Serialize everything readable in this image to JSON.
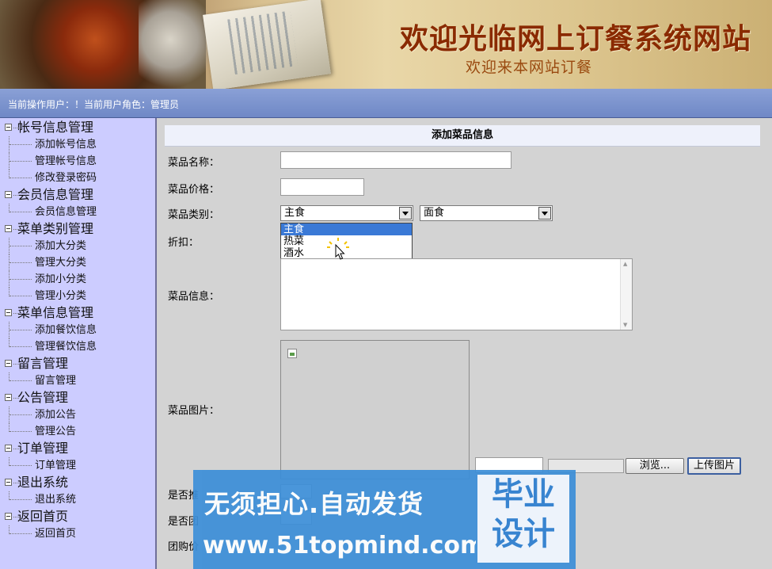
{
  "banner": {
    "title": "欢迎光临网上订餐系统网站",
    "subtitle": "欢迎来本网站订餐"
  },
  "userbar": {
    "text": "当前操作用户：！当前用户角色：管理员"
  },
  "sidebar": {
    "groups": [
      {
        "label": "帐号信息管理",
        "items": [
          "添加帐号信息",
          "管理帐号信息",
          "修改登录密码"
        ]
      },
      {
        "label": "会员信息管理",
        "items": [
          "会员信息管理"
        ]
      },
      {
        "label": "菜单类别管理",
        "items": [
          "添加大分类",
          "管理大分类",
          "添加小分类",
          "管理小分类"
        ]
      },
      {
        "label": "菜单信息管理",
        "items": [
          "添加餐饮信息",
          "管理餐饮信息"
        ]
      },
      {
        "label": "留言管理",
        "items": [
          "留言管理"
        ]
      },
      {
        "label": "公告管理",
        "items": [
          "添加公告",
          "管理公告"
        ]
      },
      {
        "label": "订单管理",
        "items": [
          "订单管理"
        ]
      },
      {
        "label": "退出系统",
        "items": [
          "退出系统"
        ]
      },
      {
        "label": "返回首页",
        "items": [
          "返回首页"
        ]
      }
    ]
  },
  "form": {
    "header": "添加菜品信息",
    "name_label": "菜品名称：",
    "name_value": "",
    "price_label": "菜品价格：",
    "price_value": "",
    "category_label": "菜品类别：",
    "category_main_selected": "主食",
    "category_sub_selected": "面食",
    "category_options": [
      "主食",
      "热菜",
      "酒水"
    ],
    "discount_label": "折扣：",
    "info_label": "菜品信息：",
    "info_value": "",
    "image_label": "菜品图片：",
    "browse_button": "浏览...",
    "upload_button": "上传图片",
    "rec_label_partial": "是否推",
    "group_label_partial": "是否团",
    "group_price_label_partial": "团购价"
  },
  "watermark": {
    "line1": "无须担心.自动发货",
    "line2": "www.51topmind.com",
    "box_line1": "毕业",
    "box_line2": "设计"
  },
  "colors": {
    "sidebar_bg": "#ccccff",
    "userbar_bg": "#6f88c6",
    "dropdown_selected": "#3a79d6",
    "watermark_bg": "#3d8fd8"
  }
}
